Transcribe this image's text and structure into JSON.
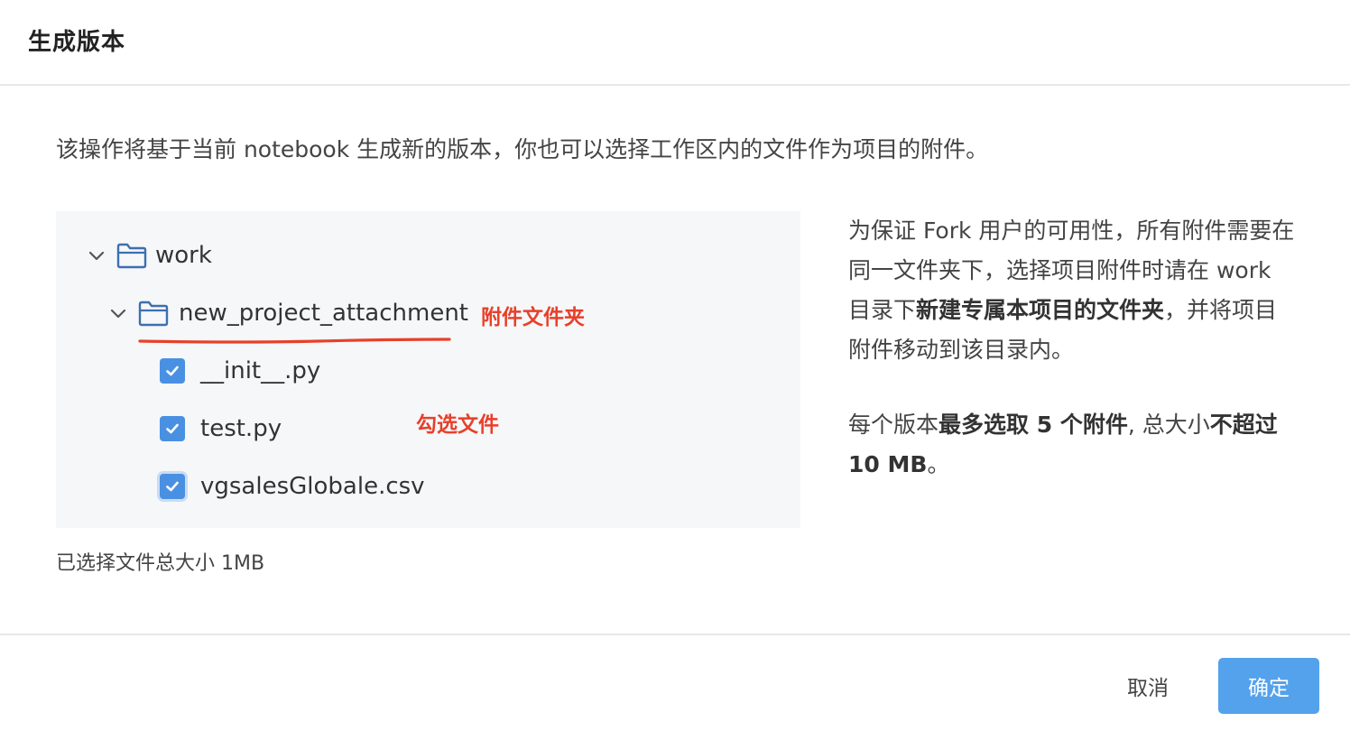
{
  "dialog": {
    "title": "生成版本",
    "intro": "该操作将基于当前 notebook 生成新的版本，你也可以选择工作区内的文件作为项目的附件。"
  },
  "tree": {
    "root": {
      "label": "work",
      "expanded": true,
      "icon": "folder-icon"
    },
    "folder": {
      "label": "new_project_attachment",
      "expanded": true,
      "icon": "folder-icon"
    },
    "files": [
      {
        "label": "__init__.py",
        "checked": true
      },
      {
        "label": "test.py",
        "checked": true
      },
      {
        "label": "vgsalesGlobale.csv",
        "checked": true
      }
    ]
  },
  "annotations": {
    "folder_note": "附件文件夹",
    "check_note": "勾选文件",
    "color": "#e8402a"
  },
  "size_note": "已选择文件总大小 1MB",
  "side_info": {
    "p1_part1": "为保证 Fork 用户的可用性，所有附件需要在同一文件夹下，选择项目附件时请在 work 目录下",
    "p1_bold": "新建专属本项目的文件夹",
    "p1_part2": "，并将项目附件移动到该目录内。",
    "p2_part1": "每个版本",
    "p2_bold1": "最多选取 5 个附件",
    "p2_part2": ", 总大小",
    "p2_bold2": "不超过 10 MB",
    "p2_part3": "。"
  },
  "footer": {
    "cancel_label": "取消",
    "ok_label": "确定"
  },
  "colors": {
    "accent": "#54a1ec",
    "checkbox": "#4a90e2",
    "folder_icon": "#3d6fb0"
  }
}
